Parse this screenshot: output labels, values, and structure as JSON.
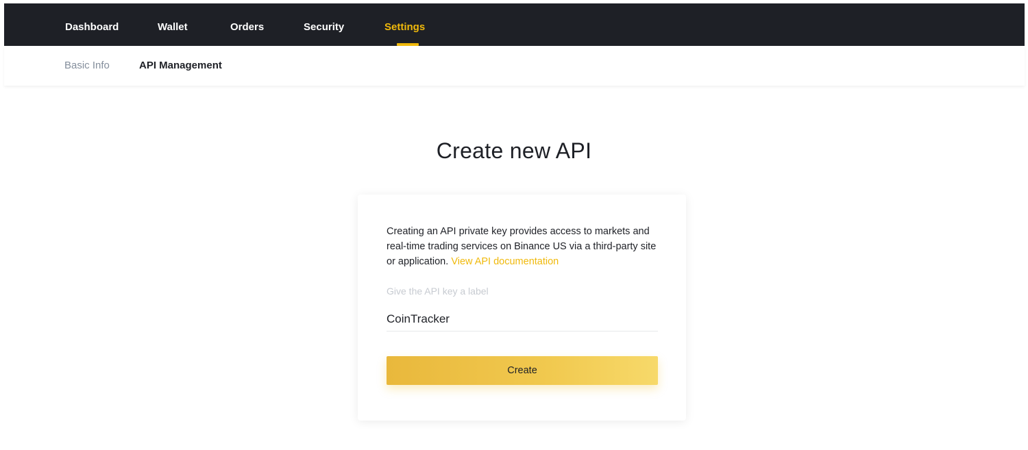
{
  "topnav": {
    "items": [
      {
        "label": "Dashboard",
        "active": false
      },
      {
        "label": "Wallet",
        "active": false
      },
      {
        "label": "Orders",
        "active": false
      },
      {
        "label": "Security",
        "active": false
      },
      {
        "label": "Settings",
        "active": true
      }
    ]
  },
  "subnav": {
    "items": [
      {
        "label": "Basic Info",
        "active": false
      },
      {
        "label": "API Management",
        "active": true
      }
    ]
  },
  "main": {
    "title": "Create new API",
    "description": "Creating an API private key provides access to markets and real-time trading services on Binance US via a third-party site or application.",
    "doc_link": "View API documentation",
    "field_label": "Give the API key a label",
    "field_value": "CoinTracker",
    "create_label": "Create"
  },
  "colors": {
    "nav_background": "#1e2026",
    "accent": "#f0b90b",
    "text_primary": "#1e2026",
    "text_muted": "#848e9c"
  }
}
